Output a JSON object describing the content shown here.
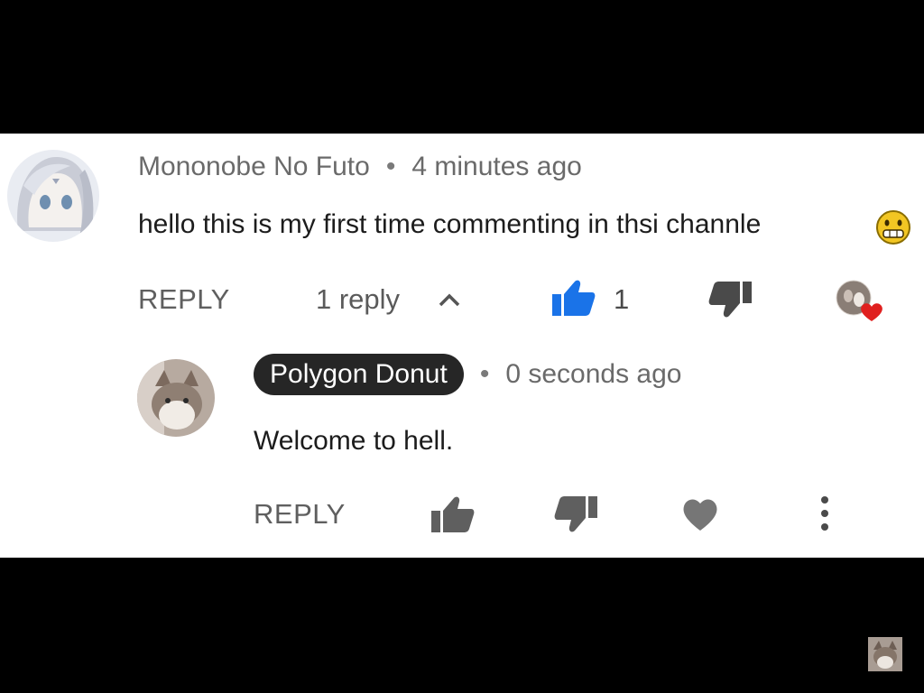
{
  "comment": {
    "author": "Mononobe No Futo",
    "timestamp": "4 minutes ago",
    "body": "hello this is my first time commenting in thsi channle",
    "emoji": "grimace-emoji",
    "reply_label": "REPLY",
    "replies_toggle": "1 reply",
    "like_count": "1",
    "liked": true,
    "hearted_by_creator": true,
    "icons": [
      "chevron-up-icon",
      "thumbs-up-icon",
      "thumbs-down-icon",
      "creator-heart-icon"
    ]
  },
  "reply": {
    "author": "Polygon Donut",
    "timestamp": "0 seconds ago",
    "body": "Welcome to hell.",
    "reply_label": "REPLY",
    "icons": [
      "thumbs-up-icon",
      "thumbs-down-icon",
      "heart-icon",
      "more-options-icon"
    ]
  },
  "colors": {
    "like_active": "#1a73e8",
    "heart": "#e0201f",
    "author_pill_bg": "#262626",
    "icon_gray": "#5f5f5f"
  }
}
